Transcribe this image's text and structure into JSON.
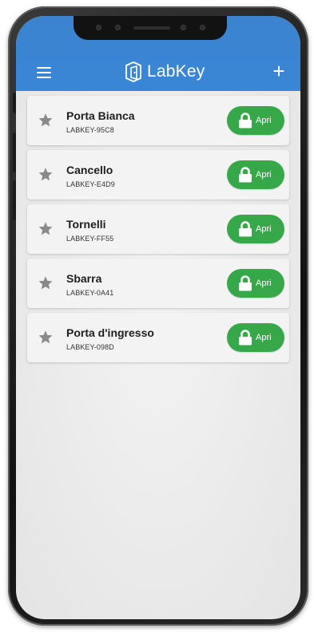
{
  "colors": {
    "appbar": "#3a86d6",
    "open_button": "#37a84a",
    "star": "#8a8a8a",
    "card": "#f3f3f3"
  },
  "header": {
    "app_name": "LabKey",
    "add_label": "+",
    "menu_icon": "hamburger-menu-icon",
    "logo_icon": "labkey-door-logo-icon"
  },
  "devices": [
    {
      "name": "Porta Bianca",
      "code": "LABKEY-95C8",
      "button_label": "Apri",
      "favorite": false
    },
    {
      "name": "Cancello",
      "code": "LABKEY-E4D9",
      "button_label": "Apri",
      "favorite": false
    },
    {
      "name": "Tornelli",
      "code": "LABKEY-FF55",
      "button_label": "Apri",
      "favorite": false
    },
    {
      "name": "Sbarra",
      "code": "LABKEY-0A41",
      "button_label": "Apri",
      "favorite": false
    },
    {
      "name": "Porta d'ingresso",
      "code": "LABKEY-098D",
      "button_label": "Apri",
      "favorite": false
    }
  ]
}
